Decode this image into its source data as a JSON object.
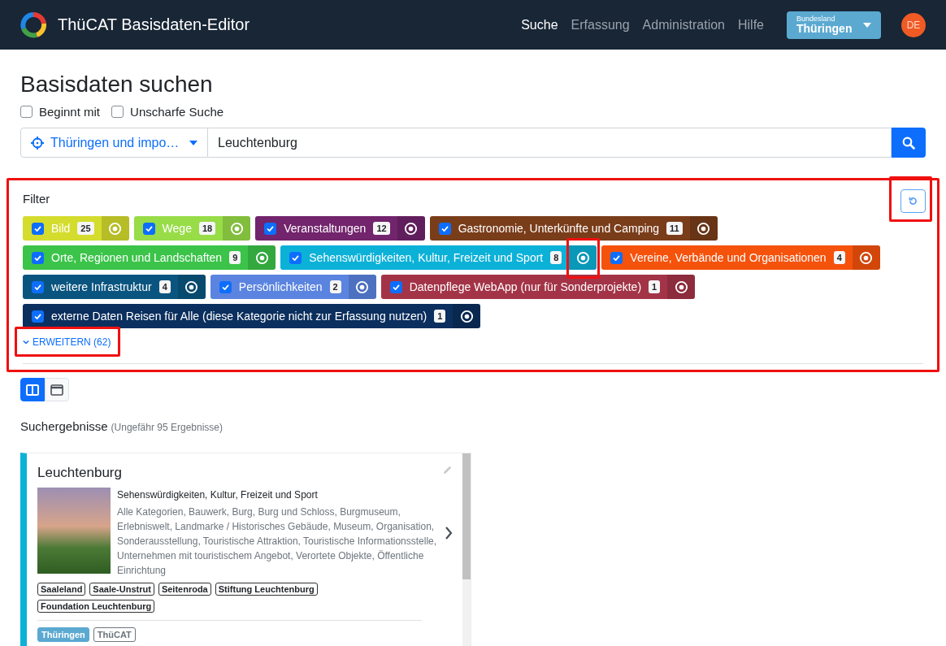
{
  "header": {
    "app_title": "ThüCAT Basisdaten-Editor",
    "nav": [
      {
        "label": "Suche",
        "selected": true
      },
      {
        "label": "Erfassung",
        "selected": false
      },
      {
        "label": "Administration",
        "selected": false
      },
      {
        "label": "Hilfe",
        "selected": false
      }
    ],
    "state_selector": {
      "caption": "Bundesland",
      "value": "Thüringen"
    },
    "avatar": "DE"
  },
  "page_title": "Basisdaten suchen",
  "options": [
    {
      "label": "Beginnt mit",
      "checked": false
    },
    {
      "label": "Unscharfe Suche",
      "checked": false
    }
  ],
  "search": {
    "scope": "Thüringen und impo…",
    "value": "Leuchtenburg"
  },
  "filter": {
    "title": "Filter",
    "highlighted": true,
    "reset_highlighted": true,
    "categories": [
      {
        "label": "Bild",
        "count": "25",
        "checked": true,
        "color": "#d4dc2e",
        "focus_highlighted": false
      },
      {
        "label": "Wege",
        "count": "18",
        "checked": true,
        "color": "#98dc48",
        "focus_highlighted": false
      },
      {
        "label": "Veranstaltungen",
        "count": "12",
        "checked": true,
        "color": "#72246c",
        "focus_highlighted": false
      },
      {
        "label": "Gastronomie, Unterkünfte und Camping",
        "count": "11",
        "checked": true,
        "color": "#7a3d1a",
        "focus_highlighted": false
      },
      {
        "label": "Orte, Regionen und Landschaften",
        "count": "9",
        "checked": true,
        "color": "#3bc449",
        "focus_highlighted": false
      },
      {
        "label": "Sehenswürdigkeiten, Kultur, Freizeit und Sport",
        "count": "8",
        "checked": true,
        "color": "#0cb1d8",
        "focus_highlighted": true
      },
      {
        "label": "Vereine, Verbände und Organisationen",
        "count": "4",
        "checked": true,
        "color": "#f5520c",
        "focus_highlighted": false
      },
      {
        "label": "weitere Infrastruktur",
        "count": "4",
        "checked": true,
        "color": "#0a5580",
        "focus_highlighted": false
      },
      {
        "label": "Persönlichkeiten",
        "count": "2",
        "checked": true,
        "color": "#5a84e0",
        "focus_highlighted": false
      },
      {
        "label": "Datenpflege WebApp (nur für Sonderprojekte)",
        "count": "1",
        "checked": true,
        "color": "#a33447",
        "focus_highlighted": false
      },
      {
        "label": "externe Daten Reisen für Alle (diese Kategorie nicht zur Erfassung nutzen)",
        "count": "1",
        "checked": true,
        "color": "#0b2f5e",
        "focus_highlighted": false
      }
    ],
    "expand": {
      "label": "ERWEITERN (62)",
      "highlighted": true
    }
  },
  "view_modes": [
    {
      "kind": "columns",
      "selected": true
    },
    {
      "kind": "window",
      "selected": false
    }
  ],
  "results": {
    "title": "Suchergebnisse",
    "count_note": "(Ungefähr 95 Ergebnisse)",
    "cards": [
      {
        "title": "Leuchtenburg",
        "category": "Sehenswürdigkeiten, Kultur, Freizeit und Sport",
        "keywords": "Alle Kategorien, Bauwerk, Burg, Burg und Schloss, Burgmuseum, Erlebniswelt, Landmarke / Historisches Gebäude, Museum, Organisation, Sonderausstellung, Touristische Attraktion, Touristische Informationsstelle, Unternehmen mit touristischem Angebot, Verortete Objekte, Öffentliche Einrichtung",
        "tags": [
          "Saaleland",
          "Saale-Unstrut",
          "Seitenroda",
          "Stiftung Leuchtenburg",
          "Foundation Leuchtenburg"
        ],
        "sources": [
          {
            "label": "Thüringen",
            "kind": "filled"
          },
          {
            "label": "ThüCAT",
            "kind": "outline"
          }
        ]
      }
    ]
  }
}
